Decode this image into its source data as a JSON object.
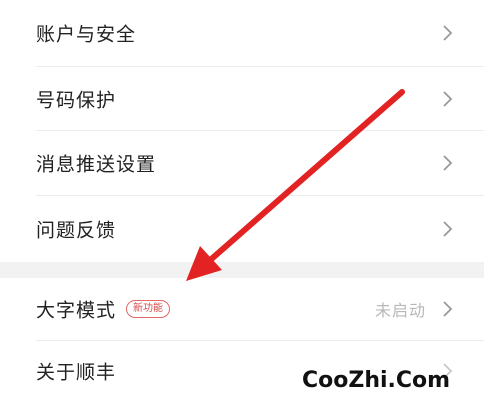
{
  "settings": {
    "items": [
      {
        "label": "账户与安全"
      },
      {
        "label": "号码保护"
      },
      {
        "label": "消息推送设置"
      },
      {
        "label": "问题反馈"
      }
    ],
    "large_text": {
      "label": "大字模式",
      "badge": "新功能",
      "status": "未启动"
    },
    "about": {
      "label": "关于顺丰"
    }
  },
  "watermark": "CooZhi.Com",
  "colors": {
    "arrow": "#e32323",
    "badge": "#d64a4a",
    "status": "#b8b8b8"
  }
}
